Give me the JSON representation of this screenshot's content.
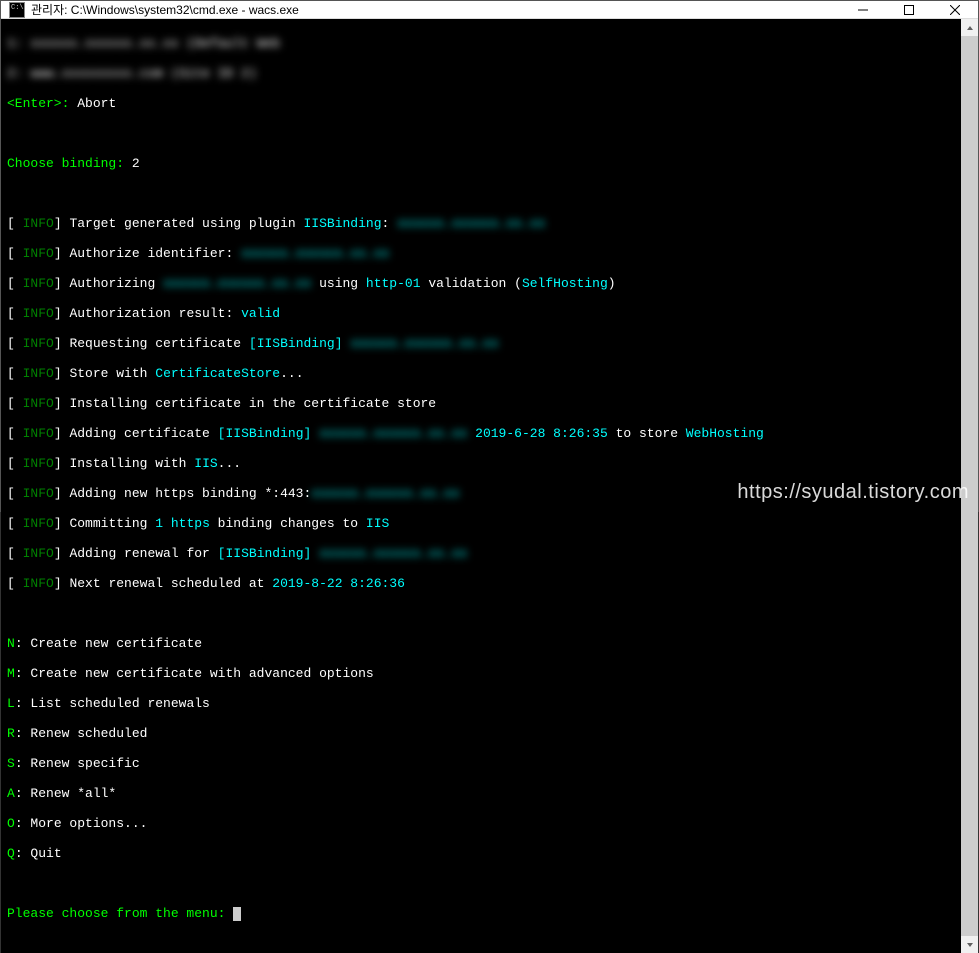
{
  "window": {
    "title": "관리자: C:\\Windows\\system32\\cmd.exe - wacs.exe"
  },
  "top_blur": {
    "line1": "1: xxxxxx.xxxxxx.xx.xx (Default Web",
    "line2": "2: www.xxxxxxxxx.com (Site ID 2)"
  },
  "enter_label": "<Enter>:",
  "enter_value": "Abort",
  "choose_binding_label": "Choose binding:",
  "choose_binding_value": "2",
  "info_tag": " INFO",
  "lines": {
    "target_gen": "Target generated using plugin ",
    "iisbinding": "IISBinding",
    "colon": ": ",
    "blur_host1": "xxxxxx.xxxxxx.xx.xx",
    "auth_ident": "Authorize identifier: ",
    "blur_host2": "xxxxxx.xxxxxx.xx.xx",
    "authorizing": "Authorizing ",
    "blur_host3": "xxxxxx.xxxxxx.xx.xx",
    "using": " using ",
    "http01": "http-01",
    "validation_open": " validation (",
    "selfhosting": "SelfHosting",
    "validation_close": ")",
    "auth_result": "Authorization result: ",
    "valid": "valid",
    "req_cert": "Requesting certificate ",
    "blur_host4": "xxxxxx.xxxxxx.xx.xx",
    "store_with": "Store with ",
    "certstore": "CertificateStore",
    "dots": "...",
    "install_cert": "Installing certificate in the certificate store",
    "add_cert": "Adding certificate ",
    "blur_host5": "xxxxxx.xxxxxx.xx.xx",
    "space": " ",
    "date1": "2019-6-28 8:26:35",
    "to_store": " to store ",
    "webhosting": "WebHosting",
    "install_iis": "Installing with ",
    "iis": "IIS",
    "add_https": "Adding new https binding *:443:",
    "blur_host6": "xxxxxx.xxxxxx.xx.xx",
    "committing": "Committing ",
    "one_https": "1 https",
    "binding_changes": " binding changes to ",
    "add_renewal": "Adding renewal for ",
    "blur_host7": "xxxxxx.xxxxxx.xx.xx",
    "next_renewal": "Next renewal scheduled at ",
    "date2": "2019-8-22 8:26:36"
  },
  "menu": {
    "n_key": "N",
    "n_label": "Create new certificate",
    "m_key": "M",
    "m_label": "Create new certificate with advanced options",
    "l_key": "L",
    "l_label": "List scheduled renewals",
    "r_key": "R",
    "r_label": "Renew scheduled",
    "s_key": "S",
    "s_label": "Renew specific",
    "a_key": "A",
    "a_label": "Renew *all*",
    "o_key": "O",
    "o_label": "More options...",
    "q_key": "Q",
    "q_label": "Quit"
  },
  "prompt": "Please choose from the menu:",
  "watermark": "https://syudal.tistory.com"
}
